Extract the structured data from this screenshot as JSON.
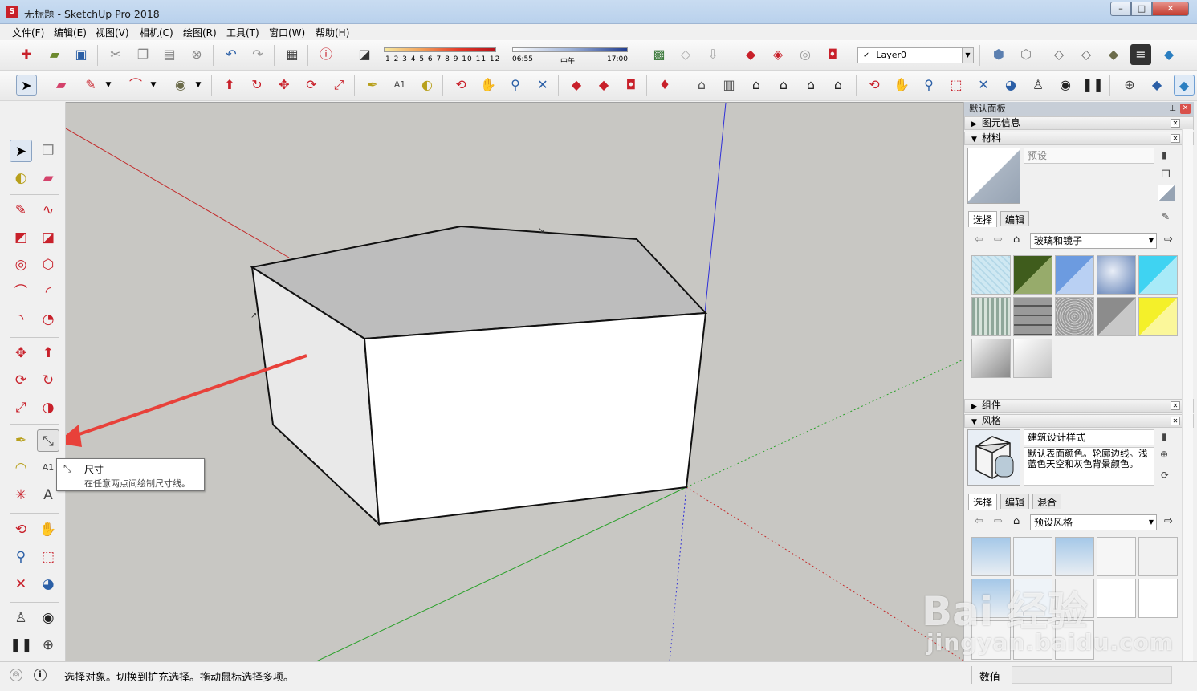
{
  "window": {
    "title": "无标题 - SketchUp Pro 2018",
    "app_icon": "sketchup-logo",
    "controls": {
      "minimize": "–",
      "maximize": "□",
      "close": "✕"
    }
  },
  "menu": [
    "文件(F)",
    "编辑(E)",
    "视图(V)",
    "相机(C)",
    "绘图(R)",
    "工具(T)",
    "窗口(W)",
    "帮助(H)"
  ],
  "toolbar1": {
    "shadow_ticks": "1 2 3 4 5 6 7 8 9 10 11 12",
    "time_start": "06:55",
    "time_mid": "中午",
    "time_end": "17:00",
    "layer": "Layer0",
    "layer_check": "✓"
  },
  "viewport": {
    "background": "#c8c7c3",
    "tooltip": {
      "title": "尺寸",
      "description": "在任意两点间绘制尺寸线。"
    }
  },
  "tray": {
    "title": "默认面板",
    "pin": "⊥",
    "close": "✕",
    "sections": {
      "entity_info": "图元信息",
      "materials": "材料",
      "components": "组件",
      "styles": "风格"
    },
    "materials": {
      "name_placeholder": "预设",
      "tabs": [
        "选择",
        "编辑"
      ],
      "library": "玻璃和镜子"
    },
    "styles": {
      "name": "建筑设计样式",
      "description": "默认表面颜色。轮廓边线。浅蓝色天空和灰色背景颜色。",
      "tabs": [
        "选择",
        "编辑",
        "混合"
      ],
      "library": "预设风格"
    }
  },
  "status": {
    "message": "选择对象。切换到扩充选择。拖动鼠标选择多项。",
    "value_label": "数值",
    "value": ""
  },
  "watermark": {
    "main": "Bai 经验",
    "sub": "jingyan.baidu.com"
  },
  "colors": {
    "accent_red": "#e8413a",
    "axis_red": "#c42b2b",
    "axis_green": "#2aa12a",
    "axis_blue": "#2f2fd8",
    "face_front": "#ffffff",
    "face_side": "#e9e9e9",
    "face_top": "#bdbdbd"
  }
}
